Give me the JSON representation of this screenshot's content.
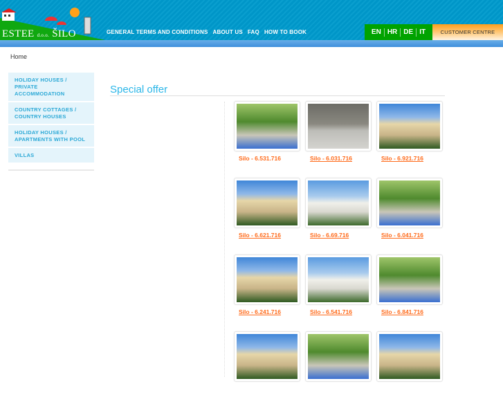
{
  "logo": {
    "name": "ESTEE",
    "suffix": "d.o.o.",
    "place": "ŠILO"
  },
  "topnav": [
    "GENERAL TERMS AND CONDITIONS",
    "ABOUT US",
    "FAQ",
    "HOW TO BOOK"
  ],
  "languages": [
    "EN",
    "HR",
    "DE",
    "IT"
  ],
  "customer_centre": "CUSTOMER CENTRE",
  "breadcrumb": "Home",
  "sidebar": [
    {
      "line1": "HOLIDAY HOUSES /",
      "line2": "PRIVATE ACCOMMODATION"
    },
    {
      "line1": "COUNTRY COTTAGES /",
      "line2": "COUNTRY HOUSES"
    },
    {
      "line1": "HOLIDAY HOUSES /",
      "line2": "APARTMENTS WITH POOL"
    },
    {
      "line1": "VILLAS",
      "line2": ""
    }
  ],
  "section_title": "Special offer",
  "colors": {
    "header": "#0096c8",
    "accent": "#2ab6e8",
    "link": "#ff6a1a",
    "lang": "#00a300"
  },
  "listings": [
    {
      "caption": "Silo - 6.531.716",
      "photo": "garden"
    },
    {
      "caption": "Silo - 6.031.716",
      "photo": "stone"
    },
    {
      "caption": "Silo - 6.921.716",
      "photo": "house"
    },
    {
      "caption": "Silo - 6.621.716",
      "photo": "house"
    },
    {
      "caption": "Silo - 6.69.716",
      "photo": "white"
    },
    {
      "caption": "Silo - 6.041.716",
      "photo": "garden"
    },
    {
      "caption": "Silo - 6.241.716",
      "photo": "house"
    },
    {
      "caption": "Silo - 6.541.716",
      "photo": "white"
    },
    {
      "caption": "Silo - 6.841.716",
      "photo": "garden"
    },
    {
      "caption": "",
      "photo": "house"
    },
    {
      "caption": "",
      "photo": "garden"
    },
    {
      "caption": "",
      "photo": "house"
    }
  ]
}
